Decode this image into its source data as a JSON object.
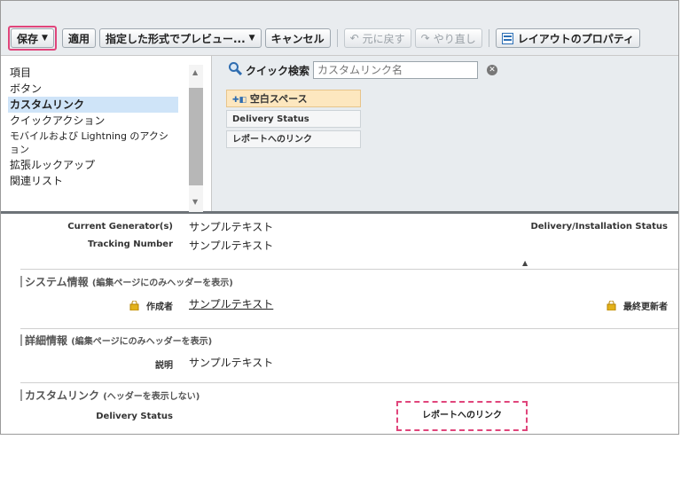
{
  "toolbar": {
    "save": "保存",
    "apply": "適用",
    "preview": "指定した形式でプレビュー...",
    "cancel": "キャンセル",
    "undo": "元に戻す",
    "redo": "やり直し",
    "layout_props": "レイアウトのプロパティ"
  },
  "palette": {
    "categories": [
      "項目",
      "ボタン",
      "カスタムリンク",
      "クイックアクション",
      "モバイルおよび Lightning のアクシ",
      "ョン",
      "拡張ルックアップ",
      "関連リスト"
    ],
    "selected_category": "カスタムリンク",
    "quick_find_label": "クイック検索",
    "quick_find_placeholder": "カスタムリンク名",
    "items": [
      "空白スペース",
      "Delivery Status",
      "レポートへのリンク"
    ]
  },
  "body": {
    "fields_top": [
      {
        "label": "Current Generator(s)",
        "value": "サンプルテキスト"
      },
      {
        "label": "Tracking Number",
        "value": "サンプルテキスト"
      }
    ],
    "right_top_label": "Delivery/Installation Status",
    "system_section": "システム情報",
    "system_section_sub": "(編集ページにのみヘッダーを表示)",
    "created_by_label": "作成者",
    "created_by_value": "サンプルテキスト",
    "last_modified_label": "最終更新者",
    "detail_section": "詳細情報",
    "detail_section_sub": "(編集ページにのみヘッダーを表示)",
    "description_label": "説明",
    "description_value": "サンプルテキスト",
    "custom_link_section": "カスタムリンク",
    "custom_link_section_sub": "(ヘッダーを表示しない)",
    "custom_link_1": "Delivery Status",
    "custom_link_2": "レポートへのリンク"
  },
  "colors": {
    "highlight": "#e0457b",
    "selected": "#cfe4f8",
    "toolbar_bg": "#e9ecef"
  }
}
